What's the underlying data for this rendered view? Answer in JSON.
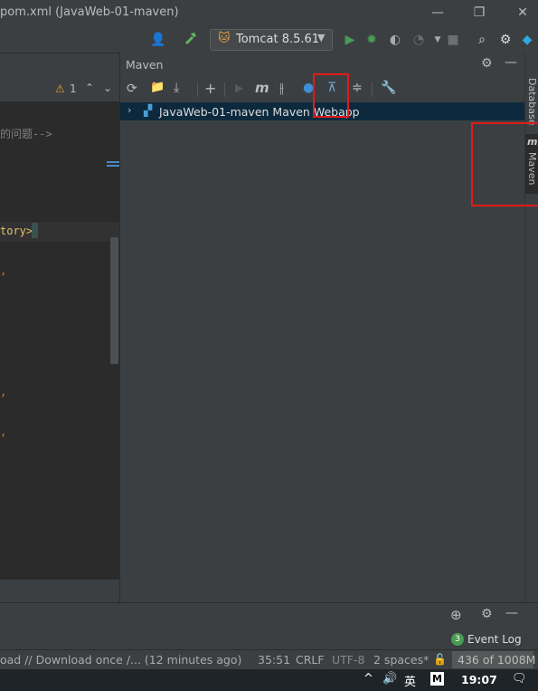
{
  "window": {
    "title": "pom.xml (JavaWeb-01-maven)",
    "minimize": "—",
    "restore": "❐",
    "close": "✕"
  },
  "run_toolbar": {
    "run_config": "Tomcat 8.5.61"
  },
  "editor": {
    "problems_count": "1",
    "line_comment": "的问题-->",
    "line_tag": "tory>"
  },
  "maven": {
    "title": "Maven",
    "project_name": "JavaWeb-01-maven Maven Webapp"
  },
  "side_tabs": {
    "database": "Database",
    "maven": "Maven"
  },
  "bottom": {
    "event_log_count": "3",
    "event_log_label": "Event Log"
  },
  "status_bar": {
    "message": "oad // Download once /... (12 minutes ago)",
    "position": "35:51",
    "line_sep": "CRLF",
    "encoding": "UTF-8",
    "indent": "2 spaces*",
    "memory": "436 of 1008M"
  },
  "taskbar": {
    "ime": "英",
    "time": "19:07"
  },
  "colors": {
    "accent_green": "#499c54",
    "highlight_red": "#e01b1b",
    "selection": "#0d293e"
  }
}
